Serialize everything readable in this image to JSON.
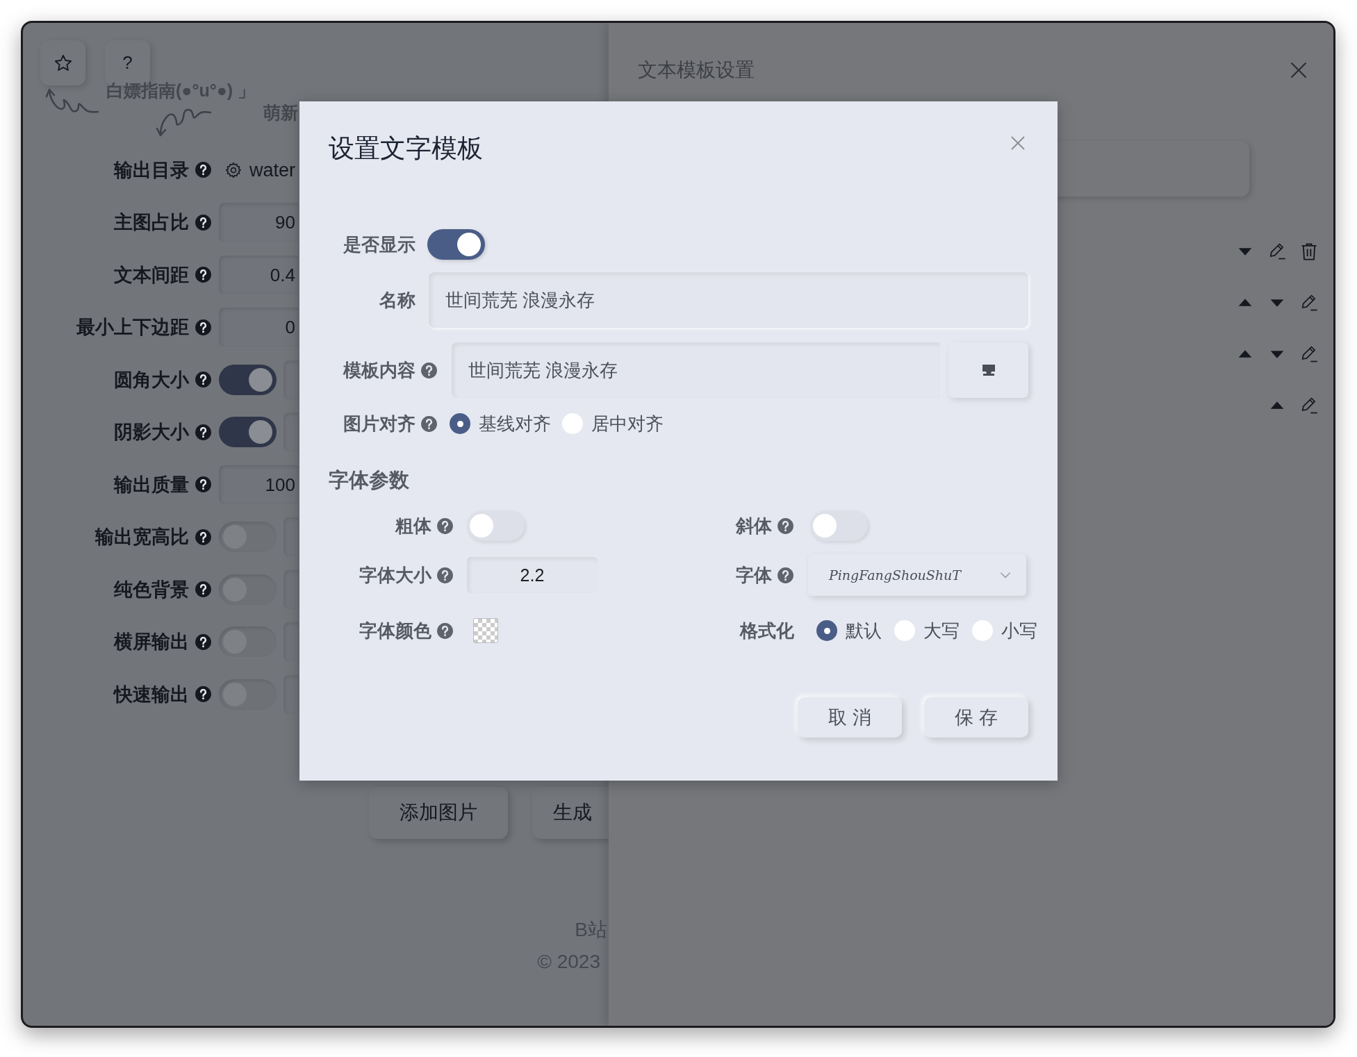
{
  "app": {
    "help_button": "?",
    "guide": "白嫖指南(●°u°●) 」",
    "guide_2": "萌新",
    "settings": [
      {
        "kind": "path",
        "label": "输出目录",
        "value": "water"
      },
      {
        "kind": "input",
        "label": "主图占比",
        "value": "90"
      },
      {
        "kind": "input",
        "label": "文本间距",
        "value": "0.4"
      },
      {
        "kind": "input",
        "label": "最小上下边距",
        "value": "0"
      },
      {
        "kind": "toggle",
        "label": "圆角大小",
        "on": true
      },
      {
        "kind": "toggle",
        "label": "阴影大小",
        "on": true
      },
      {
        "kind": "input",
        "label": "输出质量",
        "value": "100"
      },
      {
        "kind": "toggle",
        "label": "输出宽高比",
        "on": false
      },
      {
        "kind": "toggle",
        "label": "纯色背景",
        "on": false
      },
      {
        "kind": "toggle",
        "label": "横屏输出",
        "on": false
      },
      {
        "kind": "toggle",
        "label": "快速输出",
        "on": false
      }
    ],
    "buttons": [
      "添加图片",
      "生成"
    ],
    "footer": [
      "B站",
      "© 2023"
    ]
  },
  "drawer": {
    "title": "文本模板设置",
    "rows": [
      {
        "can_move_up": false,
        "can_move_down": true,
        "can_delete": true
      },
      {
        "can_move_up": true,
        "can_move_down": true,
        "can_delete": false
      },
      {
        "can_move_up": true,
        "can_move_down": true,
        "can_delete": false
      },
      {
        "can_move_up": true,
        "can_move_down": false,
        "can_delete": false
      }
    ]
  },
  "dialog": {
    "title": "设置文字模板",
    "show": {
      "label": "是否显示",
      "on": true
    },
    "name": {
      "label": "名称",
      "value": "世间荒芜 浪漫永存"
    },
    "content": {
      "label": "模板内容",
      "value": "世间荒芜 浪漫永存"
    },
    "align": {
      "label": "图片对齐",
      "options": [
        {
          "label": "基线对齐",
          "selected": true
        },
        {
          "label": "居中对齐",
          "selected": false
        }
      ]
    },
    "section": "字体参数",
    "bold": {
      "label": "粗体",
      "on": false
    },
    "italic": {
      "label": "斜体",
      "on": false
    },
    "size": {
      "label": "字体大小",
      "value": "2.2"
    },
    "font": {
      "label": "字体",
      "value": "PingFangShouShuT"
    },
    "color": {
      "label": "字体颜色"
    },
    "format": {
      "label": "格式化",
      "options": [
        {
          "label": "默认",
          "selected": true
        },
        {
          "label": "大写",
          "selected": false
        },
        {
          "label": "小写",
          "selected": false
        }
      ]
    },
    "buttons": [
      "取 消",
      "保 存"
    ]
  }
}
